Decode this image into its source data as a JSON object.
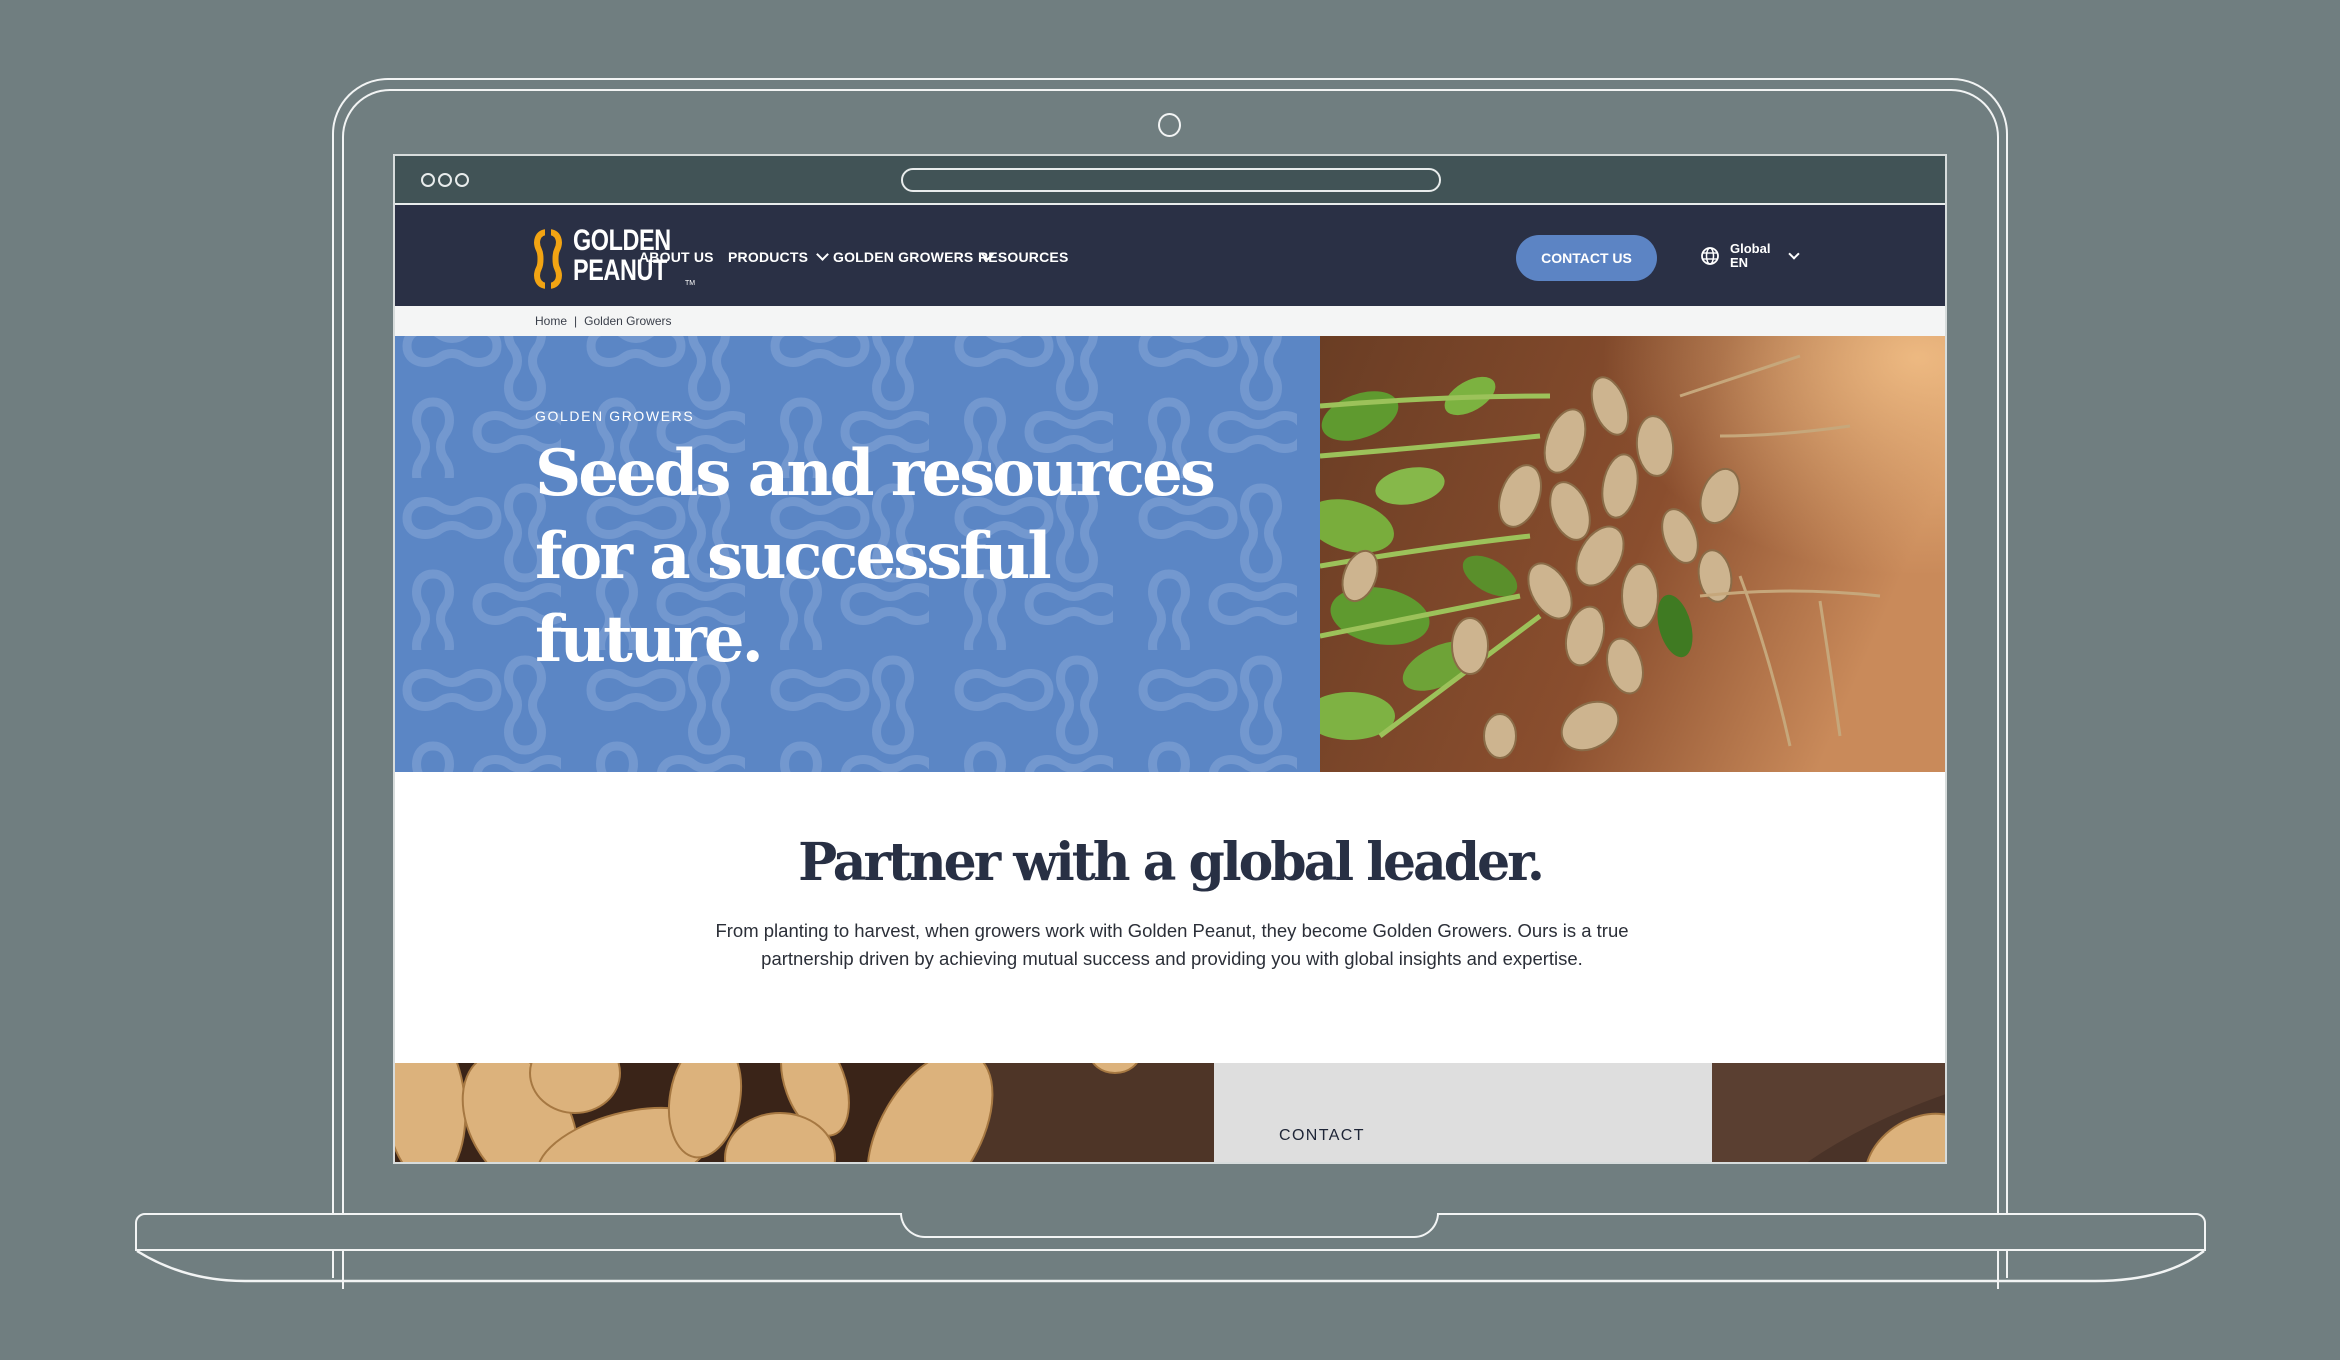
{
  "browser": {
    "window_controls": [
      "close",
      "minimize",
      "maximize"
    ],
    "address_bar": ""
  },
  "brand": {
    "line1": "GOLDEN",
    "line2": "PEANUT",
    "trademark": "TM",
    "logo_color": "#F2A413"
  },
  "nav": {
    "items": [
      {
        "label": "ABOUT US",
        "dropdown": false
      },
      {
        "label": "PRODUCTS",
        "dropdown": true
      },
      {
        "label": "GOLDEN GROWERS",
        "dropdown": true
      },
      {
        "label": "RESOURCES",
        "dropdown": false
      }
    ],
    "contact_button": "CONTACT US",
    "language": {
      "region": "Global",
      "code": "EN",
      "icon": "globe-icon"
    }
  },
  "breadcrumb": {
    "items": [
      "Home",
      "Golden Growers"
    ],
    "separator": "|"
  },
  "hero": {
    "eyebrow": "GOLDEN GROWERS",
    "title": "Seeds and resources for a successful future.",
    "image_alt": "Freshly harvested peanut plant with roots and pods on soil"
  },
  "partner": {
    "title": "Partner with a global leader.",
    "body": "From planting to harvest, when growers work with Golden Peanut, they become Golden Growers. Ours is a true partnership driven by achieving mutual success and providing you with global insights and expertise."
  },
  "bottom_strip": {
    "card_label": "CONTACT",
    "left_image_alt": "Close-up of peanuts in shell",
    "right_image_alt": "Peanut on dark burlap"
  },
  "colors": {
    "background": "#707E80",
    "browser_chrome": "#415356",
    "nav_bg": "#2A3045",
    "accent_blue": "#5B86C5",
    "heading_navy": "#283044",
    "card_gray": "#DEDEDE"
  }
}
